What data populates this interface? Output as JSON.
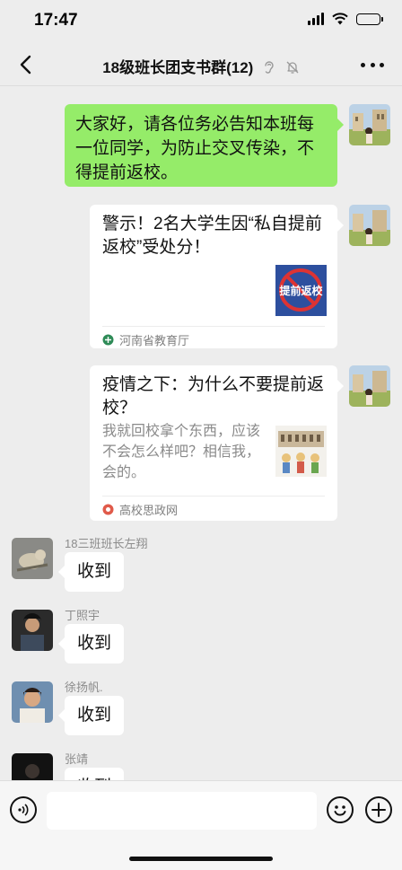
{
  "status_bar": {
    "time": "17:47"
  },
  "header": {
    "title": "18级班长团支书群(12)"
  },
  "messages": {
    "self_text": "大家好，请各位务必告知本班每一位同学，为防止交叉传染，不得提前返校。",
    "card1": {
      "title": "警示！2名大学生因“私自提前返校”受处分！",
      "thumb_text": "提前返校",
      "source": "河南省教育厅"
    },
    "card2": {
      "title": "疫情之下：为什么不要提前返校？",
      "desc": "我就回校拿个东西，应该不会怎么样吧？相信我，会的。",
      "source": "高校思政网"
    },
    "replies": [
      {
        "name": "18三班班长左翔",
        "text": "收到"
      },
      {
        "name": "丁照宇",
        "text": "收到"
      },
      {
        "name": "徐扬帆.",
        "text": "收到"
      },
      {
        "name": "张靖",
        "text": "收到"
      }
    ]
  },
  "input": {
    "placeholder": ""
  },
  "icons": {
    "back": "chevron-left-icon",
    "ear": "earpiece-mode-icon",
    "mute": "mute-bell-icon",
    "more": "more-dots-icon",
    "voice": "voice-input-icon",
    "emoji": "emoji-icon",
    "plus": "plus-icon"
  },
  "colors": {
    "self_bubble": "#95ec69",
    "background": "#ededed",
    "source1_icon": "#2e8b57",
    "source2_icon": "#e05a4a"
  }
}
